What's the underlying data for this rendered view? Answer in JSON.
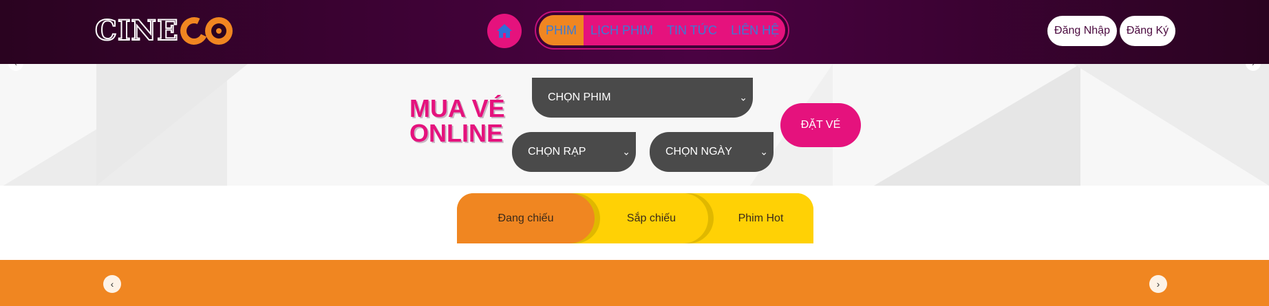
{
  "header": {
    "logo_text": "CINECO",
    "nav": [
      {
        "label": "PHIM",
        "active": true
      },
      {
        "label": "LỊCH PHIM",
        "active": false
      },
      {
        "label": "TIN TỨC",
        "active": false
      },
      {
        "label": "LIÊN HỆ",
        "active": false
      }
    ],
    "login_label": "Đăng Nhập",
    "register_label": "Đăng Ký"
  },
  "booking": {
    "title_line1": "MUA VÉ",
    "title_line2": "ONLINE",
    "select_movie": "CHỌN PHIM",
    "select_cinema": "CHỌN RẠP",
    "select_date": "CHỌN NGÀY",
    "book_label": "ĐẶT VÉ"
  },
  "tabs": {
    "now_showing": "Đang chiếu",
    "coming_soon": "Sắp chiếu",
    "hot": "Phim Hot"
  },
  "colors": {
    "brand_pink": "#e5127d",
    "brand_orange": "#f08621",
    "header_purple": "#45023d",
    "tab_yellow": "#ffd105"
  },
  "icons": {
    "home": "home-icon",
    "chevron_left": "chevron-left-icon",
    "chevron_right": "chevron-right-icon",
    "chevron_down": "chevron-down-icon"
  },
  "glyphs": {
    "chevron_left": "‹",
    "chevron_right": "›",
    "chevron_down": "⌄"
  }
}
